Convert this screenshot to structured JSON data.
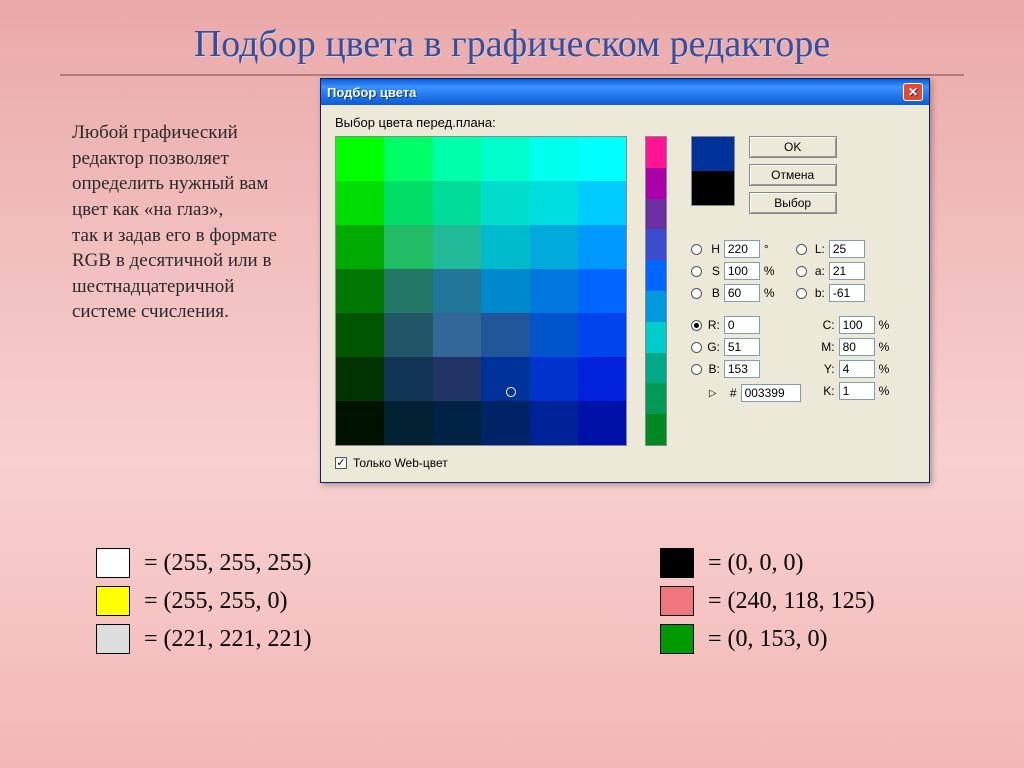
{
  "slide_title": "Подбор цвета в графическом редакторе",
  "body_text": "Любой графический редактор позволяет определить нужный вам цвет как «на глаз»,\nтак и задав его в формате\nRGB в десятичной или в шестнадцатеричной системе счисления.",
  "dialog": {
    "title": "Подбор цвета",
    "close": "✕",
    "prompt": "Выбор цвета перед.плана:",
    "buttons": {
      "ok": "OK",
      "cancel": "Отмена",
      "choose": "Выбор"
    },
    "preview": {
      "top": "#003399",
      "bottom": "#000000"
    },
    "values": {
      "H": "220",
      "S": "100",
      "B_hsb": "60",
      "L": "25",
      "a_lab": "21",
      "b_lab": "-61",
      "R": "0",
      "G": "51",
      "B_rgb": "153",
      "C": "100",
      "M": "80",
      "Y": "4",
      "K": "1",
      "hex": "003399",
      "selected_radio": "R"
    },
    "web_only": "Только Web-цвет"
  },
  "chart_data": {
    "type": "table",
    "title": "Color palette grid (6×7, green→cyan→blue→dark)",
    "palette": [
      [
        "#00ff00",
        "#00ff66",
        "#00ffaa",
        "#00ffcc",
        "#00ffee",
        "#00ffff"
      ],
      [
        "#00dd00",
        "#00dd66",
        "#00dd99",
        "#00ddcc",
        "#00dddd",
        "#00ccff"
      ],
      [
        "#00aa00",
        "#22bb66",
        "#22bb99",
        "#00bbcc",
        "#00aadd",
        "#0099ff"
      ],
      [
        "#007700",
        "#227766",
        "#227799",
        "#0088cc",
        "#0077dd",
        "#0066ff"
      ],
      [
        "#005500",
        "#225566",
        "#336699",
        "#225599",
        "#0055cc",
        "#0044ee"
      ],
      [
        "#003300",
        "#113355",
        "#223366",
        "#003399",
        "#0033cc",
        "#0022dd"
      ],
      [
        "#001100",
        "#002233",
        "#002244",
        "#002266",
        "#002299",
        "#0011aa"
      ]
    ],
    "hue_strip": [
      "#ff1493",
      "#aa00aa",
      "#6b2fa0",
      "#3b4dcc",
      "#0066ff",
      "#0099dd",
      "#00cccc",
      "#00aa88",
      "#009955",
      "#008822"
    ]
  },
  "swatches": {
    "left": [
      {
        "color": "#ffffff",
        "label": "= (255, 255, 255)"
      },
      {
        "color": "#ffff00",
        "label": "= (255, 255, 0)"
      },
      {
        "color": "#dddddd",
        "label": "= (221, 221, 221)"
      }
    ],
    "right": [
      {
        "color": "#000000",
        "label": "= (0, 0, 0)"
      },
      {
        "color": "#f0767d",
        "label": "= (240, 118, 125)"
      },
      {
        "color": "#009900",
        "label": "= (0, 153, 0)"
      }
    ]
  }
}
